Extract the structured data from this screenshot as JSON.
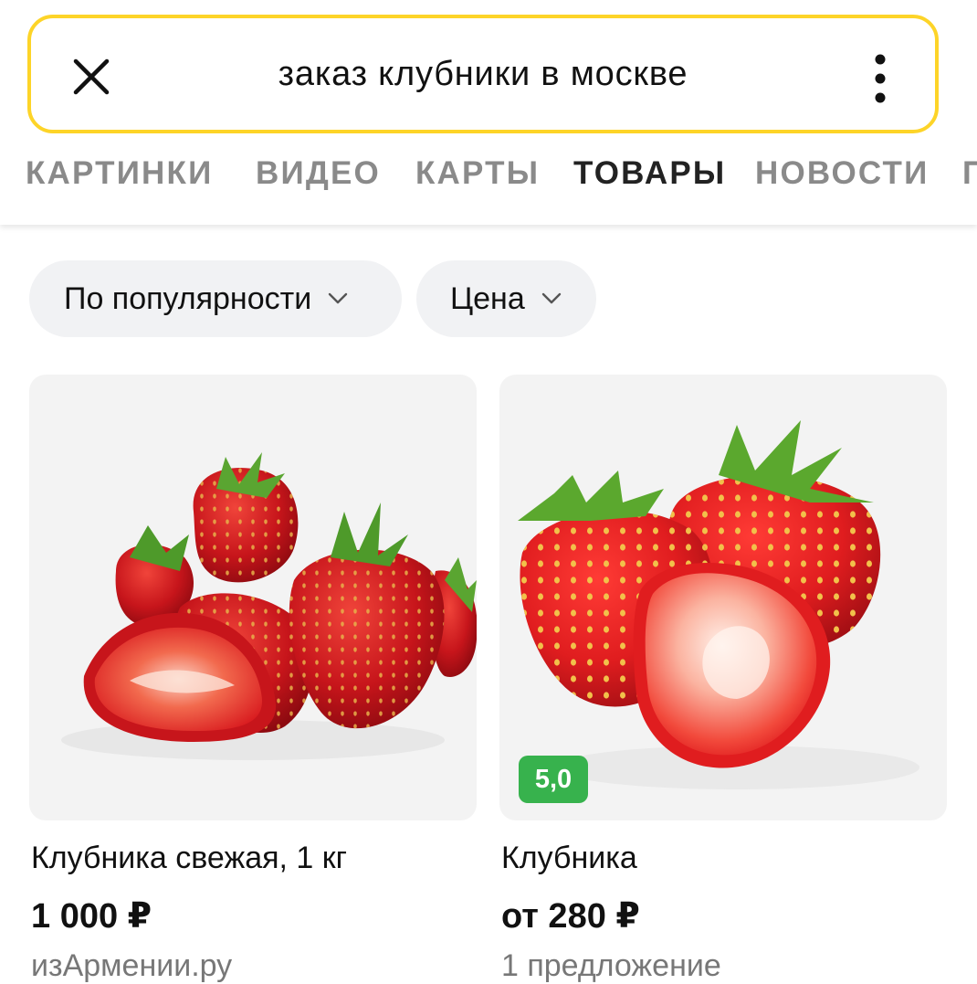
{
  "search": {
    "query": "заказ клубники в москве"
  },
  "tabs": [
    {
      "label": "КАРТИНКИ",
      "active": false
    },
    {
      "label": "ВИДЕО",
      "active": false
    },
    {
      "label": "КАРТЫ",
      "active": false
    },
    {
      "label": "ТОВАРЫ",
      "active": true
    },
    {
      "label": "НОВОСТИ",
      "active": false
    },
    {
      "label": "П",
      "active": false
    }
  ],
  "filters": {
    "sort_label": "По популярности",
    "price_label": "Цена"
  },
  "products": [
    {
      "title": "Клубника свежая, 1 кг",
      "price": "1 000 ₽",
      "subtitle": "изАрмении.ру"
    },
    {
      "title": "Клубника",
      "price": "от 280 ₽",
      "subtitle": "1 предложение",
      "rating": "5,0"
    }
  ],
  "colors": {
    "search_border": "#fdd428",
    "rating_badge": "#37b24d",
    "tab_active": "#222222",
    "tab_inactive": "#8a8a8a"
  },
  "icons": {
    "close": "close-icon",
    "menu": "more-vertical-icon",
    "chevron": "chevron-down-icon"
  }
}
